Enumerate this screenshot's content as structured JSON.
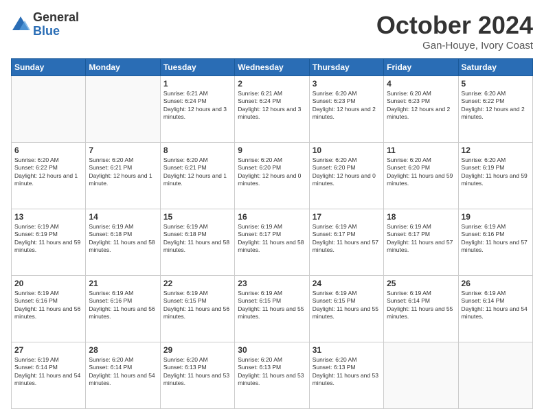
{
  "header": {
    "logo_general": "General",
    "logo_blue": "Blue",
    "month_title": "October 2024",
    "location": "Gan-Houye, Ivory Coast"
  },
  "weekdays": [
    "Sunday",
    "Monday",
    "Tuesday",
    "Wednesday",
    "Thursday",
    "Friday",
    "Saturday"
  ],
  "weeks": [
    [
      {
        "day": "",
        "sunrise": "",
        "sunset": "",
        "daylight": ""
      },
      {
        "day": "",
        "sunrise": "",
        "sunset": "",
        "daylight": ""
      },
      {
        "day": "1",
        "sunrise": "Sunrise: 6:21 AM",
        "sunset": "Sunset: 6:24 PM",
        "daylight": "Daylight: 12 hours and 3 minutes."
      },
      {
        "day": "2",
        "sunrise": "Sunrise: 6:21 AM",
        "sunset": "Sunset: 6:24 PM",
        "daylight": "Daylight: 12 hours and 3 minutes."
      },
      {
        "day": "3",
        "sunrise": "Sunrise: 6:20 AM",
        "sunset": "Sunset: 6:23 PM",
        "daylight": "Daylight: 12 hours and 2 minutes."
      },
      {
        "day": "4",
        "sunrise": "Sunrise: 6:20 AM",
        "sunset": "Sunset: 6:23 PM",
        "daylight": "Daylight: 12 hours and 2 minutes."
      },
      {
        "day": "5",
        "sunrise": "Sunrise: 6:20 AM",
        "sunset": "Sunset: 6:22 PM",
        "daylight": "Daylight: 12 hours and 2 minutes."
      }
    ],
    [
      {
        "day": "6",
        "sunrise": "Sunrise: 6:20 AM",
        "sunset": "Sunset: 6:22 PM",
        "daylight": "Daylight: 12 hours and 1 minute."
      },
      {
        "day": "7",
        "sunrise": "Sunrise: 6:20 AM",
        "sunset": "Sunset: 6:21 PM",
        "daylight": "Daylight: 12 hours and 1 minute."
      },
      {
        "day": "8",
        "sunrise": "Sunrise: 6:20 AM",
        "sunset": "Sunset: 6:21 PM",
        "daylight": "Daylight: 12 hours and 1 minute."
      },
      {
        "day": "9",
        "sunrise": "Sunrise: 6:20 AM",
        "sunset": "Sunset: 6:20 PM",
        "daylight": "Daylight: 12 hours and 0 minutes."
      },
      {
        "day": "10",
        "sunrise": "Sunrise: 6:20 AM",
        "sunset": "Sunset: 6:20 PM",
        "daylight": "Daylight: 12 hours and 0 minutes."
      },
      {
        "day": "11",
        "sunrise": "Sunrise: 6:20 AM",
        "sunset": "Sunset: 6:20 PM",
        "daylight": "Daylight: 11 hours and 59 minutes."
      },
      {
        "day": "12",
        "sunrise": "Sunrise: 6:20 AM",
        "sunset": "Sunset: 6:19 PM",
        "daylight": "Daylight: 11 hours and 59 minutes."
      }
    ],
    [
      {
        "day": "13",
        "sunrise": "Sunrise: 6:19 AM",
        "sunset": "Sunset: 6:19 PM",
        "daylight": "Daylight: 11 hours and 59 minutes."
      },
      {
        "day": "14",
        "sunrise": "Sunrise: 6:19 AM",
        "sunset": "Sunset: 6:18 PM",
        "daylight": "Daylight: 11 hours and 58 minutes."
      },
      {
        "day": "15",
        "sunrise": "Sunrise: 6:19 AM",
        "sunset": "Sunset: 6:18 PM",
        "daylight": "Daylight: 11 hours and 58 minutes."
      },
      {
        "day": "16",
        "sunrise": "Sunrise: 6:19 AM",
        "sunset": "Sunset: 6:17 PM",
        "daylight": "Daylight: 11 hours and 58 minutes."
      },
      {
        "day": "17",
        "sunrise": "Sunrise: 6:19 AM",
        "sunset": "Sunset: 6:17 PM",
        "daylight": "Daylight: 11 hours and 57 minutes."
      },
      {
        "day": "18",
        "sunrise": "Sunrise: 6:19 AM",
        "sunset": "Sunset: 6:17 PM",
        "daylight": "Daylight: 11 hours and 57 minutes."
      },
      {
        "day": "19",
        "sunrise": "Sunrise: 6:19 AM",
        "sunset": "Sunset: 6:16 PM",
        "daylight": "Daylight: 11 hours and 57 minutes."
      }
    ],
    [
      {
        "day": "20",
        "sunrise": "Sunrise: 6:19 AM",
        "sunset": "Sunset: 6:16 PM",
        "daylight": "Daylight: 11 hours and 56 minutes."
      },
      {
        "day": "21",
        "sunrise": "Sunrise: 6:19 AM",
        "sunset": "Sunset: 6:16 PM",
        "daylight": "Daylight: 11 hours and 56 minutes."
      },
      {
        "day": "22",
        "sunrise": "Sunrise: 6:19 AM",
        "sunset": "Sunset: 6:15 PM",
        "daylight": "Daylight: 11 hours and 56 minutes."
      },
      {
        "day": "23",
        "sunrise": "Sunrise: 6:19 AM",
        "sunset": "Sunset: 6:15 PM",
        "daylight": "Daylight: 11 hours and 55 minutes."
      },
      {
        "day": "24",
        "sunrise": "Sunrise: 6:19 AM",
        "sunset": "Sunset: 6:15 PM",
        "daylight": "Daylight: 11 hours and 55 minutes."
      },
      {
        "day": "25",
        "sunrise": "Sunrise: 6:19 AM",
        "sunset": "Sunset: 6:14 PM",
        "daylight": "Daylight: 11 hours and 55 minutes."
      },
      {
        "day": "26",
        "sunrise": "Sunrise: 6:19 AM",
        "sunset": "Sunset: 6:14 PM",
        "daylight": "Daylight: 11 hours and 54 minutes."
      }
    ],
    [
      {
        "day": "27",
        "sunrise": "Sunrise: 6:19 AM",
        "sunset": "Sunset: 6:14 PM",
        "daylight": "Daylight: 11 hours and 54 minutes."
      },
      {
        "day": "28",
        "sunrise": "Sunrise: 6:20 AM",
        "sunset": "Sunset: 6:14 PM",
        "daylight": "Daylight: 11 hours and 54 minutes."
      },
      {
        "day": "29",
        "sunrise": "Sunrise: 6:20 AM",
        "sunset": "Sunset: 6:13 PM",
        "daylight": "Daylight: 11 hours and 53 minutes."
      },
      {
        "day": "30",
        "sunrise": "Sunrise: 6:20 AM",
        "sunset": "Sunset: 6:13 PM",
        "daylight": "Daylight: 11 hours and 53 minutes."
      },
      {
        "day": "31",
        "sunrise": "Sunrise: 6:20 AM",
        "sunset": "Sunset: 6:13 PM",
        "daylight": "Daylight: 11 hours and 53 minutes."
      },
      {
        "day": "",
        "sunrise": "",
        "sunset": "",
        "daylight": ""
      },
      {
        "day": "",
        "sunrise": "",
        "sunset": "",
        "daylight": ""
      }
    ]
  ]
}
